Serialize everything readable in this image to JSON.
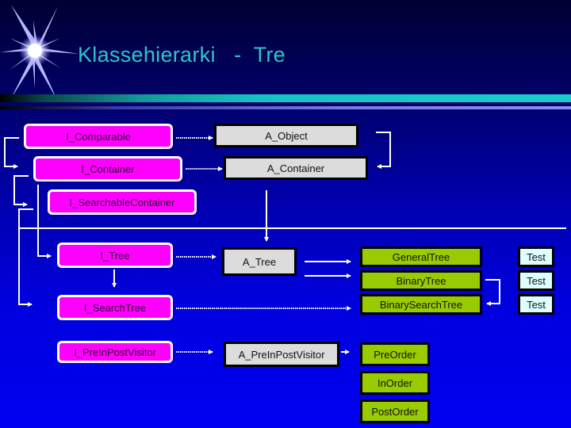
{
  "slide": {
    "title": "Klassehierarki   -  Tre",
    "decoration": "starburst-icon"
  },
  "interfaces": [
    {
      "id": "i-comparable",
      "label": "I_Comparable"
    },
    {
      "id": "i-container",
      "label": "I_Container"
    },
    {
      "id": "i-searchable-container",
      "label": "I_SearchableContainer"
    },
    {
      "id": "i-tree",
      "label": "I_Tree"
    },
    {
      "id": "i-search-tree",
      "label": "I_SearchTree"
    },
    {
      "id": "i-pre-in-post-visitor",
      "label": "I_PreInPostVisitor"
    }
  ],
  "abstract_classes": [
    {
      "id": "a-object",
      "label": "A_Object"
    },
    {
      "id": "a-container",
      "label": "A_Container"
    },
    {
      "id": "a-tree",
      "label": "A_Tree"
    },
    {
      "id": "a-pre-in-post-visitor",
      "label": "A_PreInPostVisitor"
    }
  ],
  "concrete_classes": [
    {
      "id": "general-tree",
      "label": "GeneralTree"
    },
    {
      "id": "binary-tree",
      "label": "BinaryTree"
    },
    {
      "id": "binary-search-tree",
      "label": "BinarySearchTree"
    },
    {
      "id": "pre-order",
      "label": "PreOrder"
    },
    {
      "id": "in-order",
      "label": "InOrder"
    },
    {
      "id": "post-order",
      "label": "PostOrder"
    }
  ],
  "tests": [
    {
      "for": "general-tree",
      "label": "Test"
    },
    {
      "for": "binary-tree",
      "label": "Test"
    },
    {
      "for": "binary-search-tree",
      "label": "Test"
    }
  ],
  "relations": [
    {
      "from": "I_Comparable",
      "to": "I_Container",
      "type": "extends"
    },
    {
      "from": "I_Container",
      "to": "I_SearchableContainer",
      "type": "extends"
    },
    {
      "from": "I_Container",
      "to": "I_Tree",
      "type": "extends"
    },
    {
      "from": "I_SearchableContainer",
      "to": "I_SearchTree",
      "type": "extends"
    },
    {
      "from": "I_Tree",
      "to": "I_SearchTree",
      "type": "extends"
    },
    {
      "from": "I_Comparable",
      "to": "A_Object",
      "type": "implements"
    },
    {
      "from": "I_Container",
      "to": "A_Container",
      "type": "implements"
    },
    {
      "from": "A_Object",
      "to": "A_Container",
      "type": "extends"
    },
    {
      "from": "A_Container",
      "to": "A_Tree",
      "type": "extends"
    },
    {
      "from": "I_Tree",
      "to": "A_Tree",
      "type": "implements"
    },
    {
      "from": "A_Tree",
      "to": "GeneralTree",
      "type": "extends"
    },
    {
      "from": "A_Tree",
      "to": "BinaryTree",
      "type": "extends"
    },
    {
      "from": "BinaryTree",
      "to": "BinarySearchTree",
      "type": "extends"
    },
    {
      "from": "I_SearchTree",
      "to": "BinarySearchTree",
      "type": "implements"
    },
    {
      "from": "I_PreInPostVisitor",
      "to": "A_PreInPostVisitor",
      "type": "implements"
    },
    {
      "from": "A_PreInPostVisitor",
      "to": "PreOrder",
      "type": "extends"
    }
  ],
  "colors": {
    "title": "#2ec4cc",
    "interface_fill": "#ff00ff",
    "abstract_fill": "#dcdcdc",
    "concrete_fill": "#99cc00",
    "test_fill": "#ddffff",
    "connector": "#ffffff"
  }
}
